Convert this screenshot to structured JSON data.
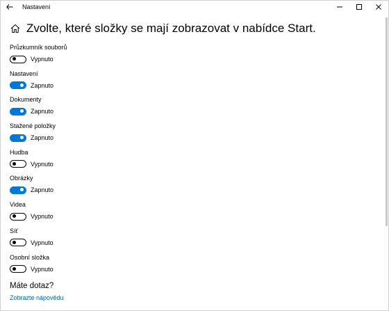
{
  "window": {
    "title": "Nastavení"
  },
  "header": {
    "title": "Zvolte, které složky se mají zobrazovat v nabídce Start."
  },
  "settings": [
    {
      "label": "Průzkumník souborů",
      "state": "Vypnuto",
      "on": false
    },
    {
      "label": "Nastavení",
      "state": "Zapnuto",
      "on": true
    },
    {
      "label": "Dokumenty",
      "state": "Zapnuto",
      "on": true
    },
    {
      "label": "Stažené položky",
      "state": "Zapnuto",
      "on": true
    },
    {
      "label": "Hudba",
      "state": "Vypnuto",
      "on": false
    },
    {
      "label": "Obrázky",
      "state": "Zapnuto",
      "on": true
    },
    {
      "label": "Videa",
      "state": "Vypnuto",
      "on": false
    },
    {
      "label": "Síť",
      "state": "Vypnuto",
      "on": false
    },
    {
      "label": "Osobní složka",
      "state": "Vypnuto",
      "on": false
    }
  ],
  "help": {
    "title": "Máte dotaz?",
    "link": "Zobrazte nápovědu"
  },
  "colors": {
    "accent": "#0078d7",
    "link": "#0063b1"
  }
}
